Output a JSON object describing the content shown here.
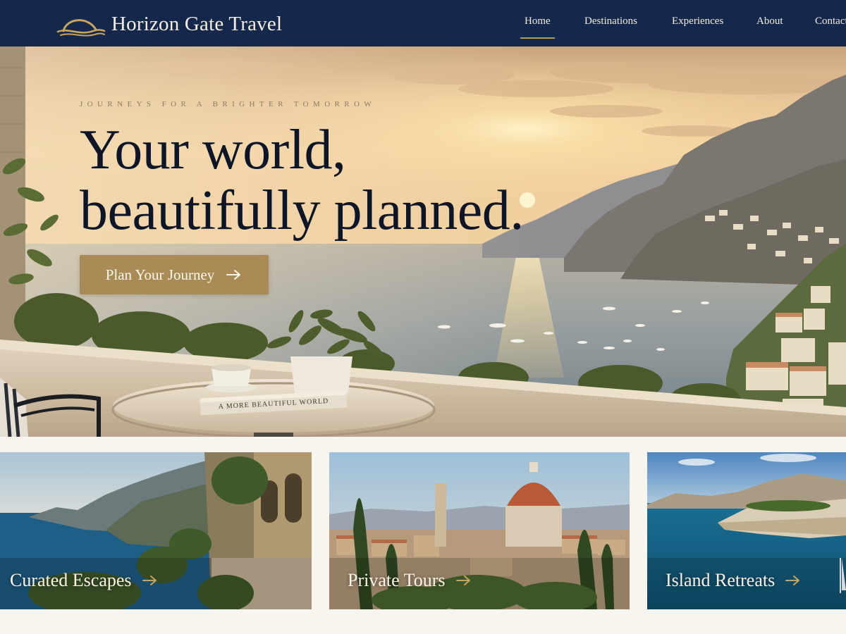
{
  "brand": {
    "name": "Horizon Gate Travel",
    "logo_icon": "sunset-arch-logo-icon"
  },
  "nav": {
    "items": [
      {
        "label": "Home",
        "active": true
      },
      {
        "label": "Destinations",
        "active": false
      },
      {
        "label": "Experiences",
        "active": false
      },
      {
        "label": "About",
        "active": false
      },
      {
        "label": "Contact",
        "active": false
      }
    ]
  },
  "hero": {
    "tagline": "JOURNEYS FOR A BRIGHTER TOMORROW",
    "headline_line1": "Your world,",
    "headline_line2": "beautifully planned.",
    "cta_label": "Plan Your Journey",
    "cta_icon": "arrow-right-icon",
    "book_title": "A MORE BEAUTIFUL WORLD"
  },
  "cards": [
    {
      "label": "Curated Escapes",
      "icon": "arrow-right-icon"
    },
    {
      "label": "Private Tours",
      "icon": "arrow-right-icon"
    },
    {
      "label": "Island Retreats",
      "icon": "arrow-right-icon"
    }
  ],
  "colors": {
    "navbar": "#13284a",
    "accent_gold": "#a98c55",
    "arrow_gold": "#c9a45c",
    "headline": "#0d1628",
    "page_background": "#f8f5ef"
  }
}
